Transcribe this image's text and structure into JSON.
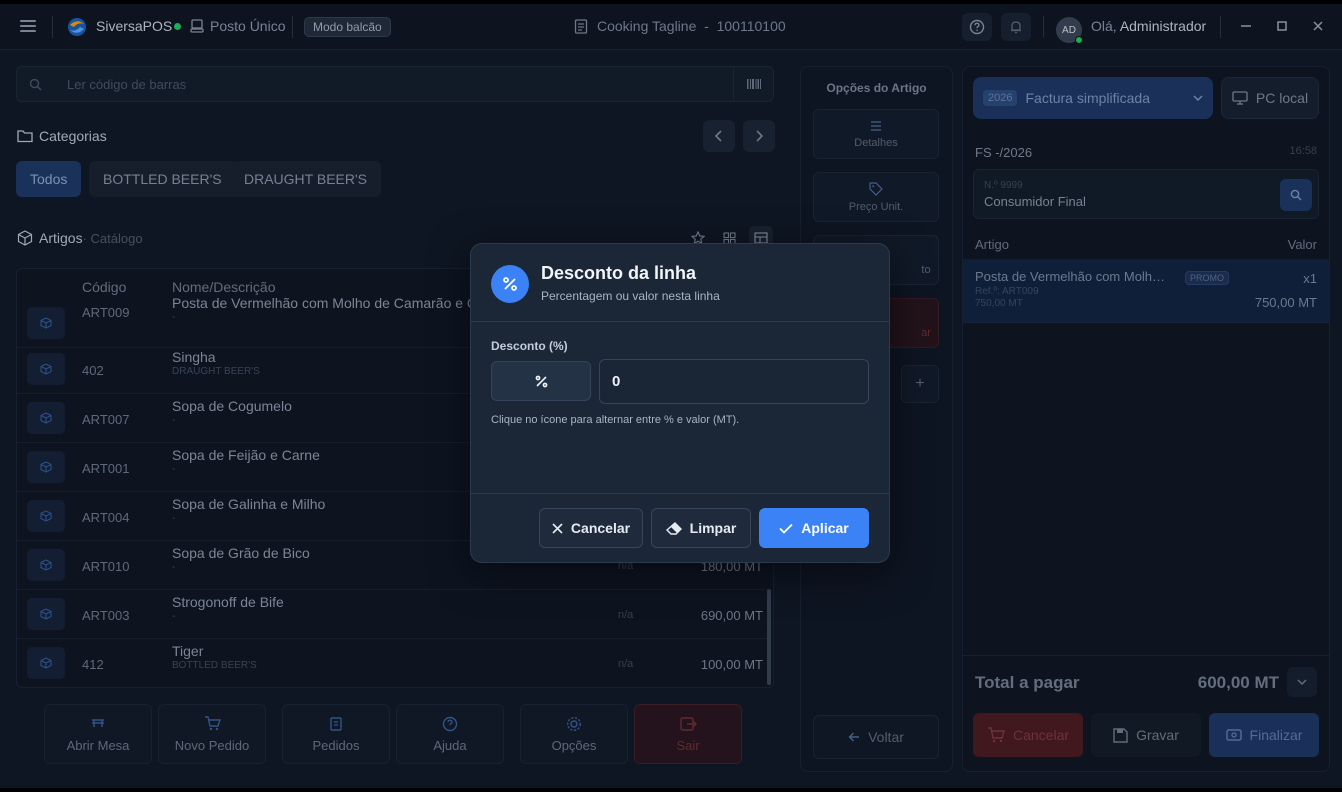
{
  "topbar": {
    "brand": "SiversaPOS",
    "station": "Posto Único",
    "mode": "Modo balcão",
    "center_title": "Cooking Tagline",
    "center_sep": "-",
    "center_code": "100110100",
    "avatar": "AD",
    "greeting_prefix": "Olá,",
    "greeting_name": "Administrador"
  },
  "search": {
    "placeholder": "Ler código de barras"
  },
  "categories": {
    "title": "Categorias",
    "items": [
      "Todos",
      "BOTTLED BEER'S",
      "DRAUGHT BEER'S"
    ]
  },
  "articles": {
    "title": "Artigos",
    "subtitle": "· Catálogo",
    "col_code": "Código",
    "col_name": "Nome/Descrição",
    "rows": [
      {
        "code": "ART009",
        "name": "Posta de Vermelhão com Molho de Camarão e Ce",
        "sub": "-",
        "na": "",
        "price": ""
      },
      {
        "code": "402",
        "name": "Singha",
        "sub": "DRAUGHT BEER'S",
        "na": "",
        "price": ""
      },
      {
        "code": "ART007",
        "name": "Sopa de Cogumelo",
        "sub": "-",
        "na": "",
        "price": ""
      },
      {
        "code": "ART001",
        "name": "Sopa de Feijão e Carne",
        "sub": "-",
        "na": "",
        "price": ""
      },
      {
        "code": "ART004",
        "name": "Sopa de Galinha e Milho",
        "sub": "-",
        "na": "",
        "price": ""
      },
      {
        "code": "ART010",
        "name": "Sopa de Grão de Bico",
        "sub": "-",
        "na": "n/a",
        "price": "180,00 MT"
      },
      {
        "code": "ART003",
        "name": "Strogonoff de Bife",
        "sub": "-",
        "na": "n/a",
        "price": "690,00 MT"
      },
      {
        "code": "412",
        "name": "Tiger",
        "sub": "BOTTLED BEER'S",
        "na": "n/a",
        "price": "100,00 MT"
      }
    ]
  },
  "bottom_actions": [
    "Abrir Mesa",
    "Novo Pedido",
    "Pedidos",
    "Ajuda",
    "Opções",
    "Sair"
  ],
  "options_panel": {
    "title": "Opções do Artigo",
    "details": "Detalhes",
    "unit_price": "Preço Unit.",
    "partial_1": "to",
    "partial_2": "ar",
    "plus": "+",
    "back": "Voltar"
  },
  "invoice": {
    "year": "2026",
    "doc_type": "Factura simplificada",
    "pc": "PC local",
    "doc_number": "FS -/2026",
    "time": "16:58",
    "customer_nif": "N.º 9999",
    "customer_name": "Consumidor Final",
    "col_item": "Artigo",
    "col_value": "Valor",
    "line": {
      "name": "Posta de Vermelhão com Molh…",
      "badge": "PROMO",
      "qty": "x1",
      "ref": "Ref.º: ART009",
      "unit": "750,00 MT",
      "total": "750,00 MT"
    },
    "total_label": "Total a pagar",
    "total_value": "600,00 MT",
    "cancel": "Cancelar",
    "save": "Gravar",
    "finish": "Finalizar"
  },
  "modal": {
    "title": "Desconto da linha",
    "subtitle": "Percentagem ou valor nesta linha",
    "field_label": "Desconto (%)",
    "value": "0",
    "hint": "Clique no ícone para alternar entre % e valor (MT).",
    "cancel": "Cancelar",
    "clear": "Limpar",
    "apply": "Aplicar"
  },
  "colors": {
    "accent": "#3b82f6",
    "background": "#111a28",
    "modal": "#1b2637",
    "danger": "#b91c1c",
    "status_online": "#22c55e"
  }
}
